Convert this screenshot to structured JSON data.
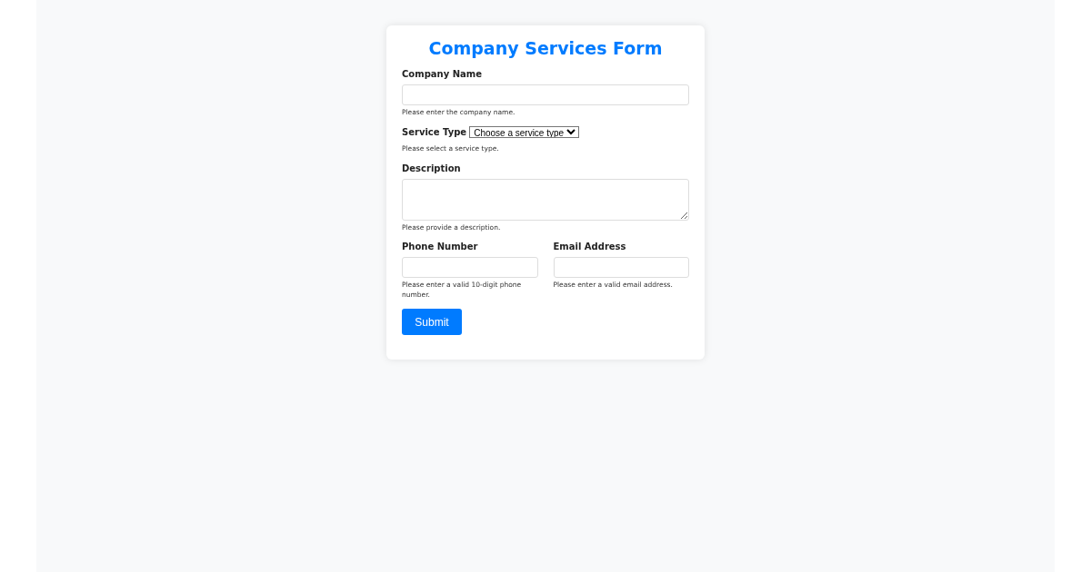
{
  "form": {
    "title": "Company Services Form",
    "company_name": {
      "label": "Company Name",
      "hint": "Please enter the company name."
    },
    "service_type": {
      "label": "Service Type",
      "value": "Choose a service type",
      "hint": "Please select a service type."
    },
    "description": {
      "label": "Description",
      "hint": "Please provide a description."
    },
    "phone": {
      "label": "Phone Number",
      "hint": "Please enter a valid 10-digit phone number."
    },
    "email": {
      "label": "Email Address",
      "hint": "Please enter a valid email address."
    },
    "submit": "Submit"
  }
}
